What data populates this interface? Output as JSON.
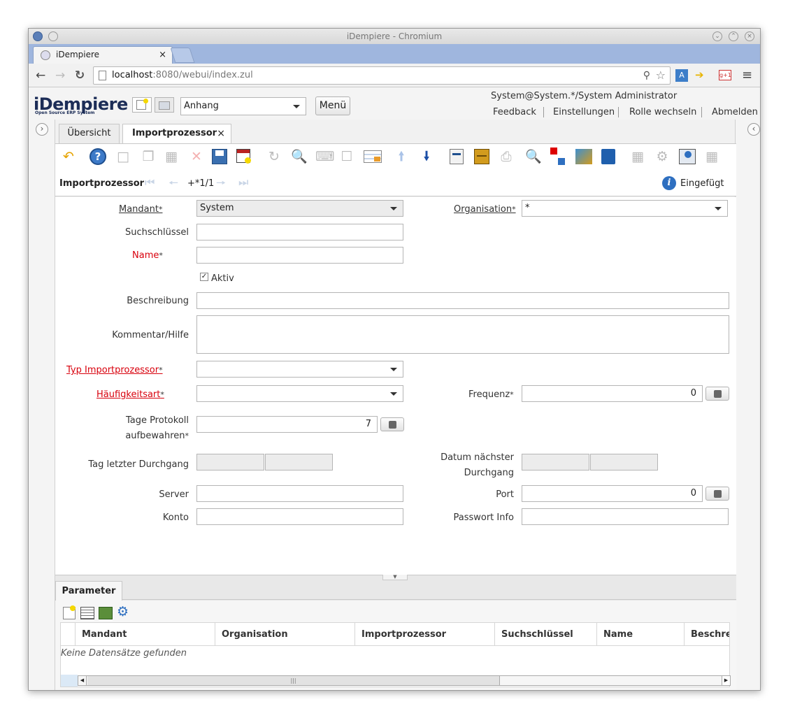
{
  "window": {
    "title": "iDempiere - Chromium"
  },
  "browser": {
    "tab_title": "iDempiere",
    "url_host": "localhost",
    "url_path": ":8080/webui/index.zul"
  },
  "header": {
    "logo": "iDempiere",
    "logo_sub": "Open Source ERP System",
    "attachment_select": "Anhang",
    "menu_button": "Menü",
    "user_info": "System@System.*/System Administrator",
    "links": [
      "Feedback",
      "Einstellungen",
      "Rolle wechseln",
      "Abmelden"
    ]
  },
  "window_tabs": {
    "overview": "Übersicht",
    "active": "Importprozessor",
    "close": "×"
  },
  "record": {
    "title": "Importprozessor",
    "navigation": "+*1/1",
    "status": "Eingefügt"
  },
  "form": {
    "mandant": {
      "label": "Mandant",
      "value": "System"
    },
    "organisation": {
      "label": "Organisation",
      "value": "*"
    },
    "suchschluessel": {
      "label": "Suchschlüssel",
      "value": ""
    },
    "name": {
      "label": "Name",
      "value": ""
    },
    "aktiv": {
      "label": "Aktiv",
      "checked": true
    },
    "beschreibung": {
      "label": "Beschreibung",
      "value": ""
    },
    "kommentar": {
      "label": "Kommentar/Hilfe",
      "value": ""
    },
    "typ": {
      "label": "Typ Importprozessor",
      "value": ""
    },
    "haeufigkeitsart": {
      "label": "Häufigkeitsart",
      "value": ""
    },
    "frequenz": {
      "label": "Frequenz",
      "value": "0"
    },
    "tage_line1": "Tage Protokoll",
    "tage_line2": "aufbewahren",
    "tage_value": "7",
    "tag_letzter": {
      "label": "Tag letzter Durchgang"
    },
    "datum_line1": "Datum nächster",
    "datum_line2": "Durchgang",
    "server": {
      "label": "Server",
      "value": ""
    },
    "port": {
      "label": "Port",
      "value": "0"
    },
    "konto": {
      "label": "Konto",
      "value": ""
    },
    "passwort": {
      "label": "Passwort Info",
      "value": ""
    },
    "required_mark": "*"
  },
  "detail": {
    "tab": "Parameter",
    "columns": [
      "Mandant",
      "Organisation",
      "Importprozessor",
      "Suchschlüssel",
      "Name",
      "Beschre"
    ],
    "empty_text": "Keine Datensätze gefunden"
  }
}
